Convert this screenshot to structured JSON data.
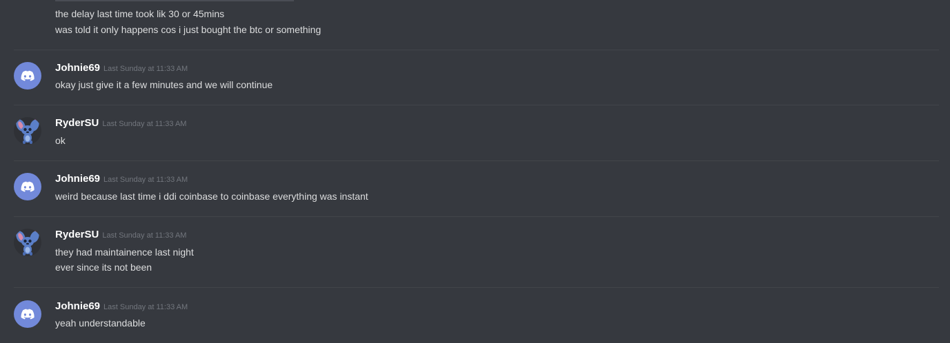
{
  "continuation": {
    "lines": [
      "the delay last time took lik 30 or 45mins",
      "was told it only happens cos i just bought the btc or something"
    ]
  },
  "messages": [
    {
      "username": "Johnie69",
      "timestamp": "Last Sunday at 11:33 AM",
      "avatar_icon": "discord-logo-icon",
      "lines": [
        "okay just give it a few minutes and we will continue"
      ]
    },
    {
      "username": "RyderSU",
      "timestamp": "Last Sunday at 11:33 AM",
      "avatar_icon": "stitch-avatar-icon",
      "lines": [
        "ok"
      ]
    },
    {
      "username": "Johnie69",
      "timestamp": "Last Sunday at 11:33 AM",
      "avatar_icon": "discord-logo-icon",
      "lines": [
        "weird because last time i ddi coinbase to coinbase everything was instant"
      ]
    },
    {
      "username": "RyderSU",
      "timestamp": "Last Sunday at 11:33 AM",
      "avatar_icon": "stitch-avatar-icon",
      "lines": [
        "they had maintainence last night",
        "ever since its not been"
      ]
    },
    {
      "username": "Johnie69",
      "timestamp": "Last Sunday at 11:33 AM",
      "avatar_icon": "discord-logo-icon",
      "lines": [
        "yeah understandable"
      ]
    }
  ],
  "colors": {
    "background": "#36393f",
    "divider": "#42454a",
    "username": "#ffffff",
    "timestamp": "#72767d",
    "message_text": "#dcddde",
    "discord_avatar": "#7289da"
  }
}
